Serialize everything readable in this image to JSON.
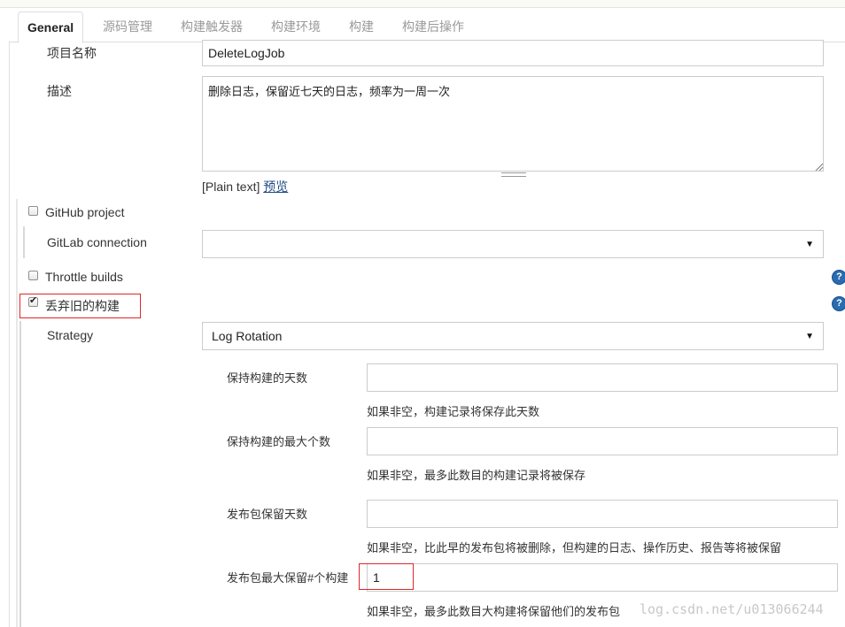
{
  "tabs": [
    {
      "label": "General"
    },
    {
      "label": "源码管理"
    },
    {
      "label": "构建触发器"
    },
    {
      "label": "构建环境"
    },
    {
      "label": "构建"
    },
    {
      "label": "构建后操作"
    }
  ],
  "project_name": {
    "label": "项目名称",
    "value": "DeleteLogJob"
  },
  "description": {
    "label": "描述",
    "value": "删除日志，保留近七天的日志，频率为一周一次",
    "format_text": "[Plain text]",
    "preview_link": "预览"
  },
  "github_project": {
    "label": "GitHub project",
    "checked": false
  },
  "gitlab_connection": {
    "label": "GitLab connection",
    "value": ""
  },
  "throttle_builds": {
    "label": "Throttle builds",
    "checked": false
  },
  "discard_old_builds": {
    "label": "丢弃旧的构建",
    "checked": true
  },
  "strategy": {
    "label": "Strategy",
    "value": "Log Rotation"
  },
  "days_to_keep": {
    "label": "保持构建的天数",
    "value": "",
    "hint": "如果非空，构建记录将保存此天数"
  },
  "max_builds": {
    "label": "保持构建的最大个数",
    "value": "",
    "hint": "如果非空，最多此数目的构建记录将被保存"
  },
  "artifact_days": {
    "label": "发布包保留天数",
    "value": "",
    "hint": "如果非空，比此早的发布包将被删除，但构建的日志、操作历史、报告等将被保留"
  },
  "artifact_max": {
    "label": "发布包最大保留#个构建",
    "value": "1",
    "hint": "如果非空，最多此数目大构建将保留他们的发布包"
  },
  "help_icon_text": "?",
  "watermark": "log.csdn.net/u013066244",
  "colors": {
    "highlight_border": "#e0262b",
    "help_icon": "#2a6cb0",
    "link": "#204a87"
  }
}
